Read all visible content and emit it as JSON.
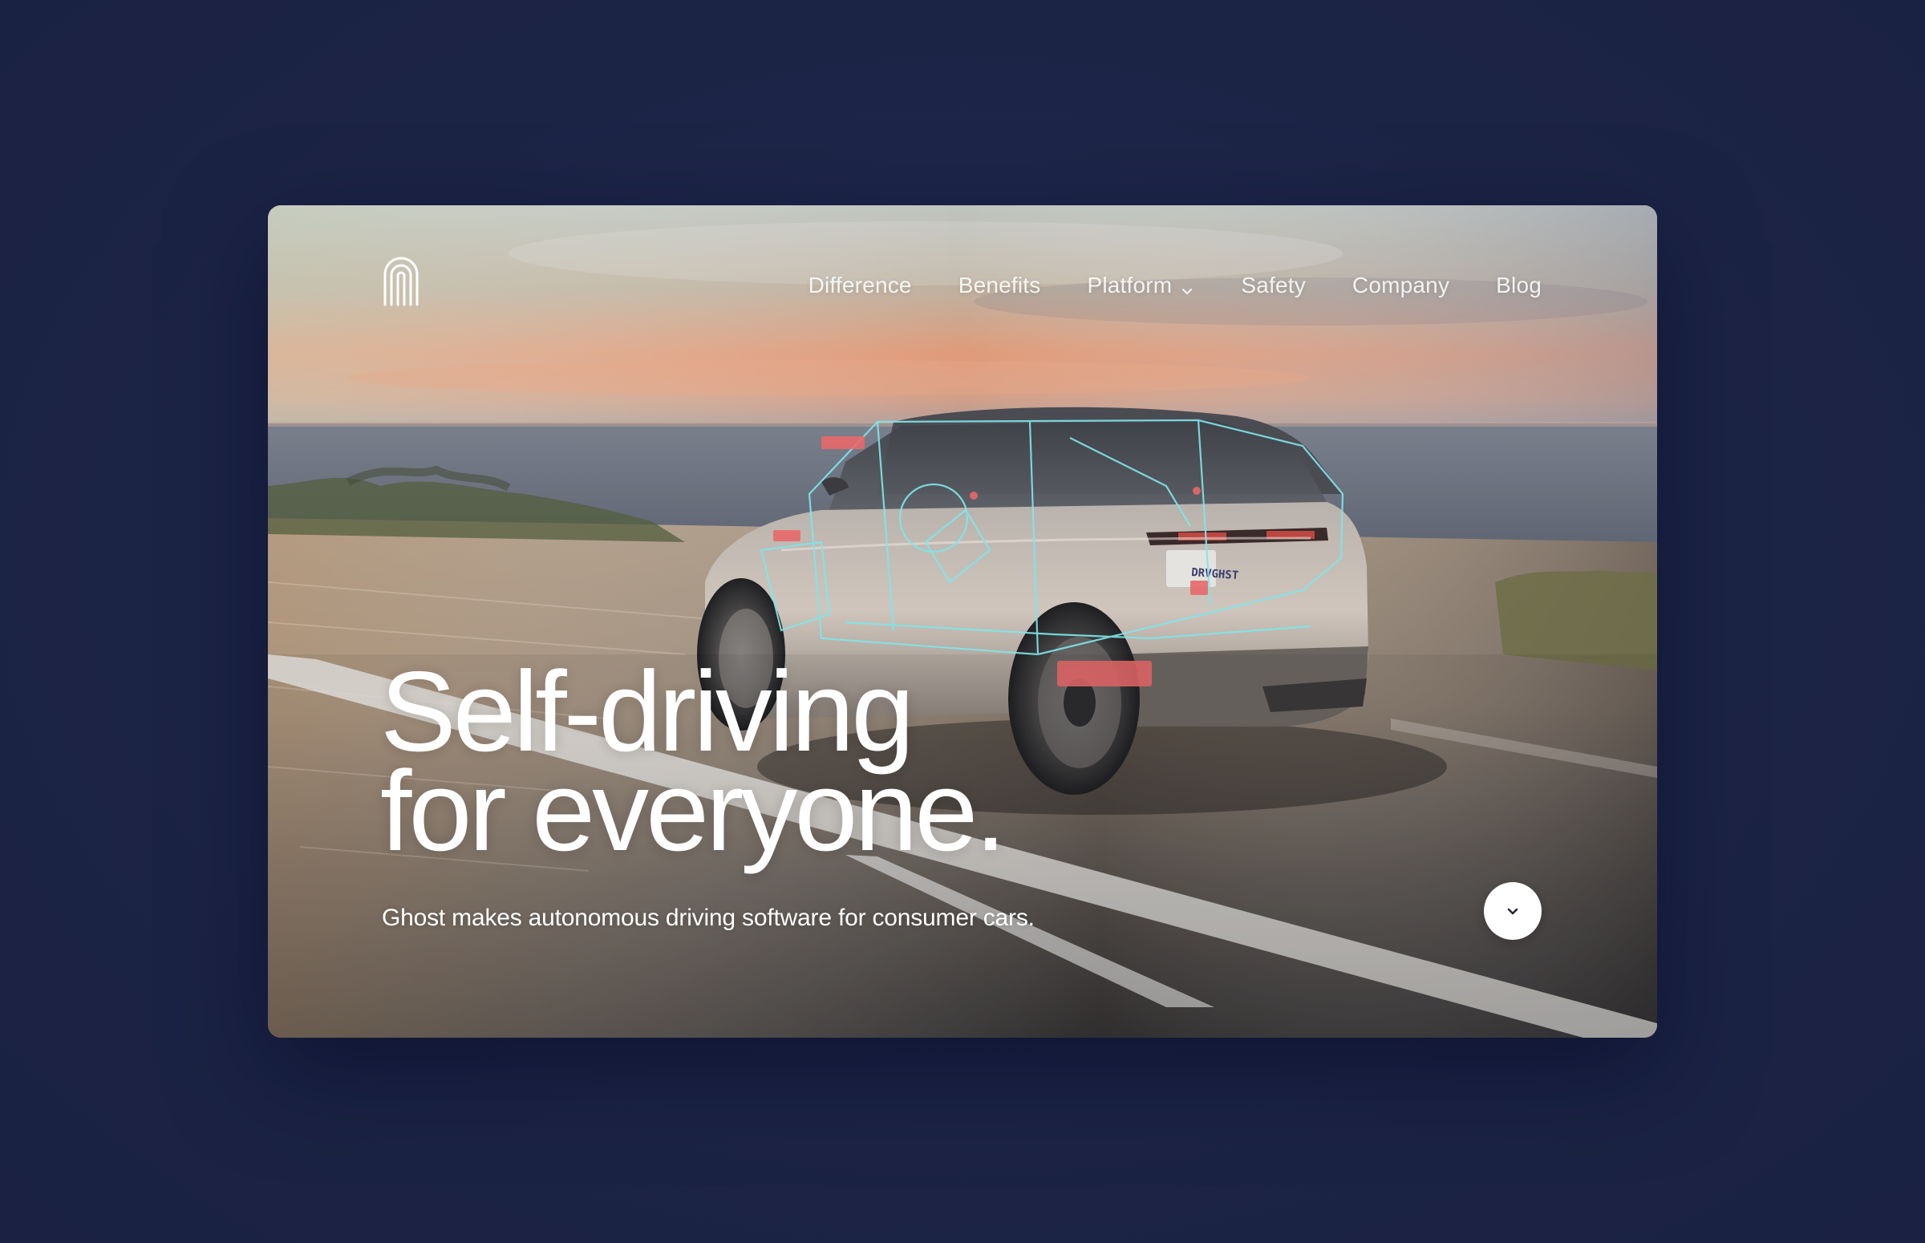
{
  "brand": {
    "logo_icon": "ghost-arch-logo-icon"
  },
  "nav": {
    "items": [
      {
        "label": "Difference"
      },
      {
        "label": "Benefits"
      },
      {
        "label": "Platform",
        "icon": "chevron-down-icon"
      },
      {
        "label": "Safety"
      },
      {
        "label": "Company"
      },
      {
        "label": "Blog"
      }
    ]
  },
  "hero": {
    "title_line1": "Self-driving",
    "title_line2": "for everyone.",
    "subtitle": "Ghost makes autonomous driving software for consumer cars.",
    "scroll_icon": "chevron-down-icon",
    "license_plate": "DRVGHST"
  },
  "colors": {
    "page_background": "#1d2548",
    "text": "#ffffff",
    "sensor_overlay": "#7fe6ea",
    "sensor_marker": "#e8696a"
  }
}
